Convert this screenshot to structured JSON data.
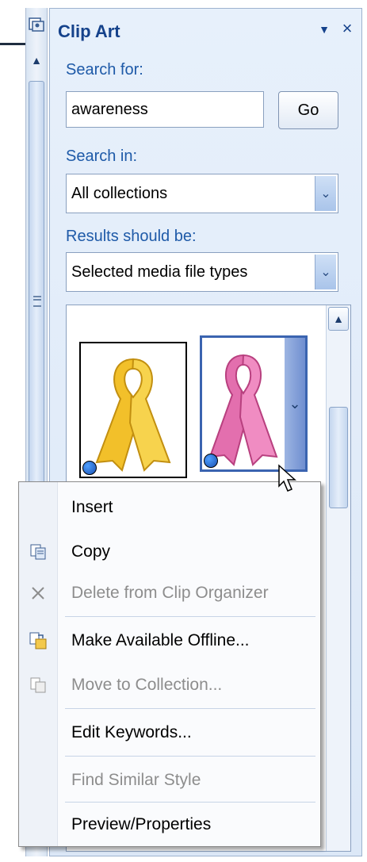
{
  "pane": {
    "title": "Clip Art",
    "menu_arrow": "▼",
    "close": "×"
  },
  "search": {
    "label": "Search for:",
    "value": "awareness",
    "go": "Go"
  },
  "search_in": {
    "label": "Search in:",
    "value": "All collections"
  },
  "results_type": {
    "label": "Results should be:",
    "value": "Selected media file types"
  },
  "results": {
    "thumbnails": [
      {
        "name": "yellow-ribbon-clip",
        "color": "#f2c02a"
      },
      {
        "name": "pink-ribbon-clip",
        "color": "#e36fae"
      }
    ]
  },
  "context_menu": {
    "items": [
      {
        "label": "Insert",
        "icon": "none",
        "enabled": true
      },
      {
        "label": "Copy",
        "icon": "copy-icon",
        "enabled": true
      },
      {
        "label": "Delete from Clip Organizer",
        "icon": "delete-icon",
        "enabled": false
      },
      {
        "label": "Make Available Offline...",
        "icon": "offline-icon",
        "enabled": true
      },
      {
        "label": "Move to Collection...",
        "icon": "move-icon",
        "enabled": false
      },
      {
        "label": "Edit Keywords...",
        "icon": "none",
        "enabled": true
      },
      {
        "label": "Find Similar Style",
        "icon": "none",
        "enabled": false
      },
      {
        "label": "Preview/Properties",
        "icon": "none",
        "enabled": true
      }
    ]
  },
  "colors": {
    "accent": "#15428b",
    "label_blue": "#1e5aa8",
    "pane_bg": "#e7f0fb",
    "disabled_text": "#8d8d8d"
  }
}
